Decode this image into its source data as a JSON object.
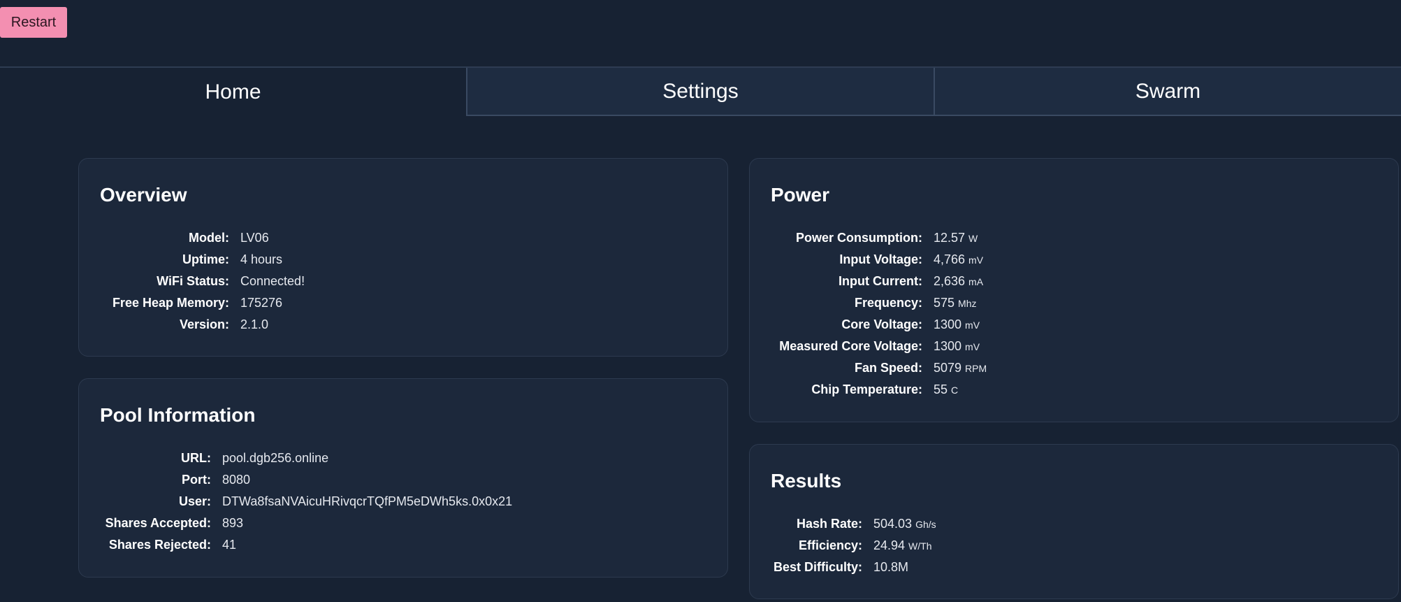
{
  "toolbar": {
    "restart_label": "Restart"
  },
  "tabs": [
    {
      "label": "Home",
      "active": true
    },
    {
      "label": "Settings",
      "active": false
    },
    {
      "label": "Swarm",
      "active": false
    }
  ],
  "overview": {
    "title": "Overview",
    "rows": [
      {
        "label": "Model:",
        "value": "LV06"
      },
      {
        "label": "Uptime:",
        "value": "4 hours"
      },
      {
        "label": "WiFi Status:",
        "value": "Connected!"
      },
      {
        "label": "Free Heap Memory:",
        "value": "175276"
      },
      {
        "label": "Version:",
        "value": "2.1.0"
      }
    ]
  },
  "pool": {
    "title": "Pool Information",
    "rows": [
      {
        "label": "URL:",
        "value": "pool.dgb256.online"
      },
      {
        "label": "Port:",
        "value": "8080"
      },
      {
        "label": "User:",
        "value": "DTWa8fsaNVAicuHRivqcrTQfPM5eDWh5ks.0x0x21"
      },
      {
        "label": "Shares Accepted:",
        "value": "893"
      },
      {
        "label": "Shares Rejected:",
        "value": "41"
      }
    ]
  },
  "power": {
    "title": "Power",
    "rows": [
      {
        "label": "Power Consumption:",
        "value": "12.57",
        "unit": "W"
      },
      {
        "label": "Input Voltage:",
        "value": "4,766",
        "unit": "mV"
      },
      {
        "label": "Input Current:",
        "value": "2,636",
        "unit": "mA"
      },
      {
        "label": "Frequency:",
        "value": "575",
        "unit": "Mhz"
      },
      {
        "label": "Core Voltage:",
        "value": "1300",
        "unit": "mV"
      },
      {
        "label": "Measured Core Voltage:",
        "value": "1300",
        "unit": "mV"
      },
      {
        "label": "Fan Speed:",
        "value": "5079",
        "unit": "RPM"
      },
      {
        "label": "Chip Temperature:",
        "value": "55",
        "unit": "C"
      }
    ]
  },
  "results": {
    "title": "Results",
    "rows": [
      {
        "label": "Hash Rate:",
        "value": "504.03",
        "unit": "Gh/s"
      },
      {
        "label": "Efficiency:",
        "value": "24.94",
        "unit": "W/Th"
      },
      {
        "label": "Best Difficulty:",
        "value": "10.8M"
      }
    ]
  }
}
